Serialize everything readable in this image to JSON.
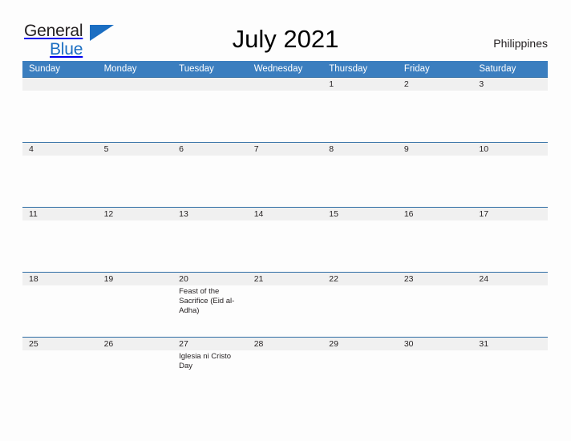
{
  "brand": {
    "name_part1": "General",
    "name_part2": "Blue",
    "flag_icon": "triangle-flag-icon",
    "color_primary": "#1b6ec2",
    "color_text": "#231f20"
  },
  "header": {
    "title": "July 2021",
    "region": "Philippines"
  },
  "theme": {
    "header_blue": "#3b7ebf",
    "row_border_blue": "#2e6da4",
    "date_stripe_gray": "#f0f0f0",
    "page_background": "#fdfdfd",
    "text_color": "#231f20"
  },
  "calendar": {
    "month": "July",
    "year": "2021",
    "weekday_headers": [
      "Sunday",
      "Monday",
      "Tuesday",
      "Wednesday",
      "Thursday",
      "Friday",
      "Saturday"
    ],
    "weeks": [
      [
        {
          "date": "",
          "events": ""
        },
        {
          "date": "",
          "events": ""
        },
        {
          "date": "",
          "events": ""
        },
        {
          "date": "",
          "events": ""
        },
        {
          "date": "1",
          "events": ""
        },
        {
          "date": "2",
          "events": ""
        },
        {
          "date": "3",
          "events": ""
        }
      ],
      [
        {
          "date": "4",
          "events": ""
        },
        {
          "date": "5",
          "events": ""
        },
        {
          "date": "6",
          "events": ""
        },
        {
          "date": "7",
          "events": ""
        },
        {
          "date": "8",
          "events": ""
        },
        {
          "date": "9",
          "events": ""
        },
        {
          "date": "10",
          "events": ""
        }
      ],
      [
        {
          "date": "11",
          "events": ""
        },
        {
          "date": "12",
          "events": ""
        },
        {
          "date": "13",
          "events": ""
        },
        {
          "date": "14",
          "events": ""
        },
        {
          "date": "15",
          "events": ""
        },
        {
          "date": "16",
          "events": ""
        },
        {
          "date": "17",
          "events": ""
        }
      ],
      [
        {
          "date": "18",
          "events": ""
        },
        {
          "date": "19",
          "events": ""
        },
        {
          "date": "20",
          "events": "Feast of the Sacrifice (Eid al-Adha)"
        },
        {
          "date": "21",
          "events": ""
        },
        {
          "date": "22",
          "events": ""
        },
        {
          "date": "23",
          "events": ""
        },
        {
          "date": "24",
          "events": ""
        }
      ],
      [
        {
          "date": "25",
          "events": ""
        },
        {
          "date": "26",
          "events": ""
        },
        {
          "date": "27",
          "events": "Iglesia ni Cristo Day"
        },
        {
          "date": "28",
          "events": ""
        },
        {
          "date": "29",
          "events": ""
        },
        {
          "date": "30",
          "events": ""
        },
        {
          "date": "31",
          "events": ""
        }
      ]
    ]
  }
}
